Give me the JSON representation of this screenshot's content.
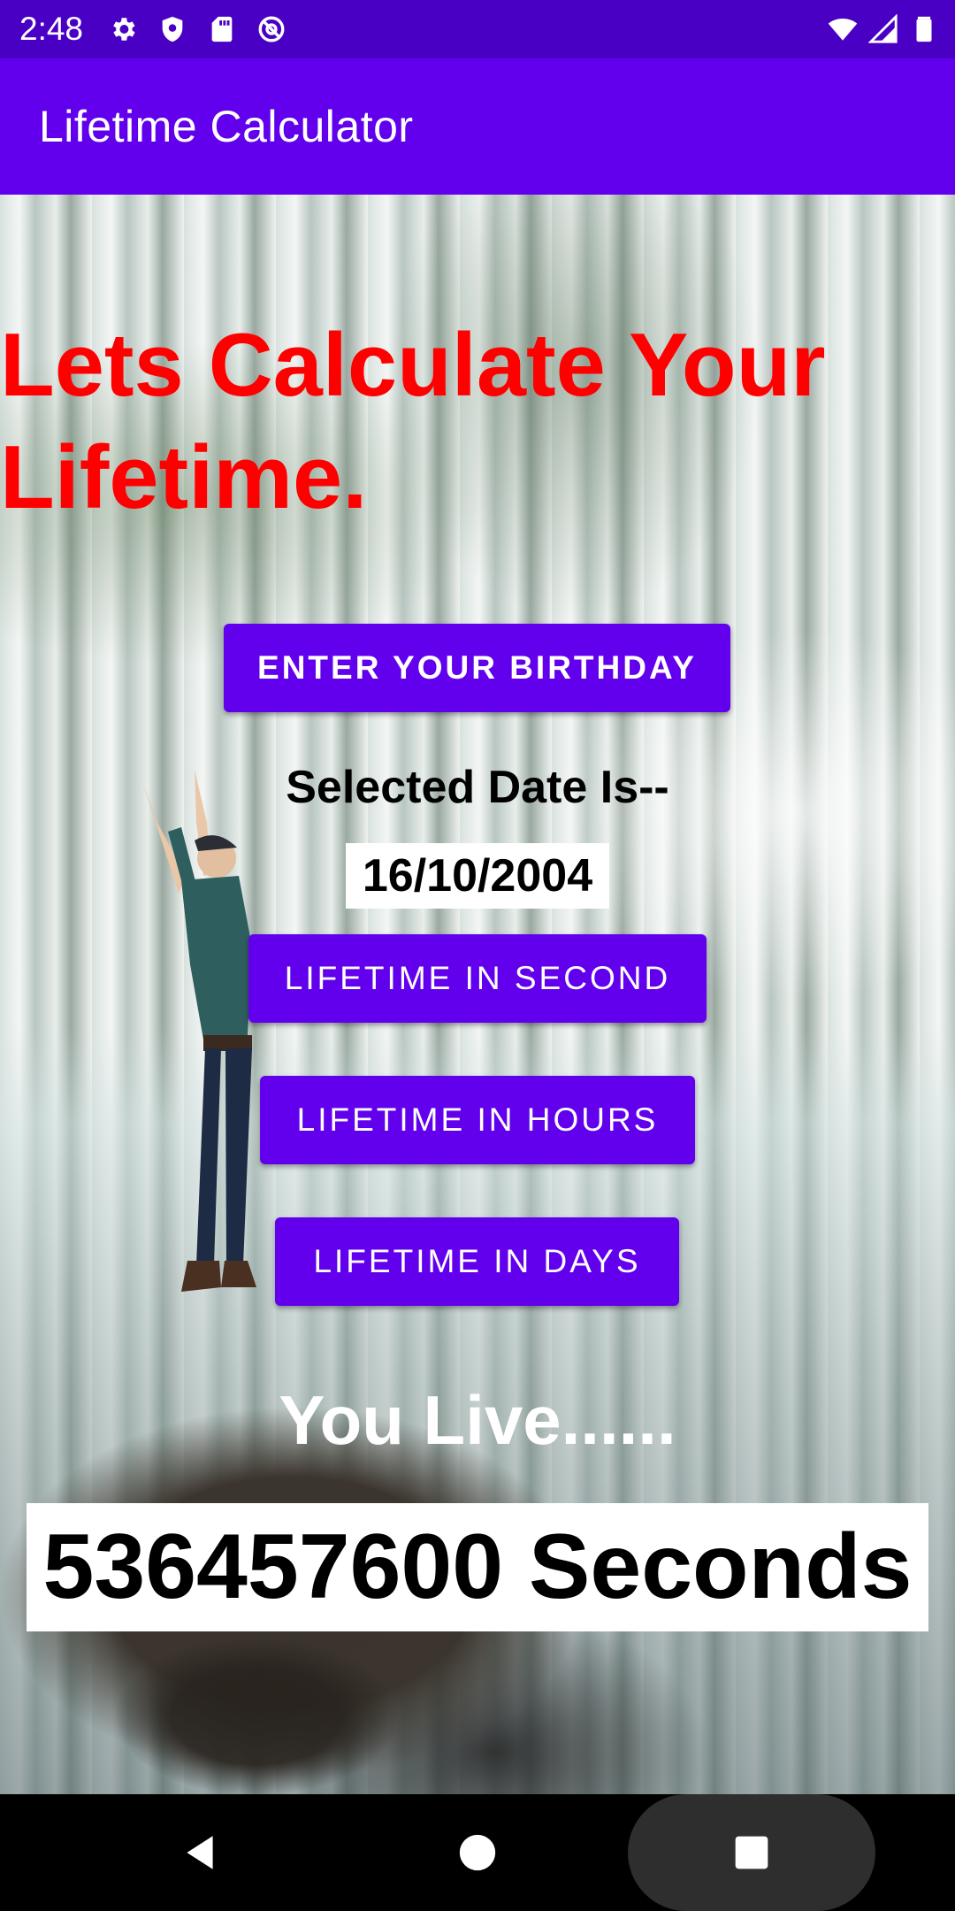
{
  "status_bar": {
    "time": "2:48",
    "left_icons": [
      "gear-icon",
      "shield-icon",
      "sd-card-icon",
      "at-sign-icon"
    ],
    "right_icons": [
      "wifi-icon",
      "cellular-signal-icon",
      "battery-icon"
    ]
  },
  "app_bar": {
    "title": "Lifetime Calculator",
    "color": "#6200ee"
  },
  "main": {
    "heading": "Lets Calculate Your Lifetime.",
    "heading_color": "#ff0000",
    "birthday_button": "ENTER YOUR BIRTHDAY",
    "selected_label": "Selected Date Is--",
    "selected_date": "16/10/2004",
    "second_button": "LIFETIME IN SECOND",
    "hours_button": "LIFETIME IN HOURS",
    "days_button": "LIFETIME IN DAYS",
    "you_live": "You Live......",
    "result": "536457600 Seconds"
  },
  "nav_bar": {
    "icons": [
      "back-icon",
      "home-icon",
      "recents-icon"
    ]
  }
}
